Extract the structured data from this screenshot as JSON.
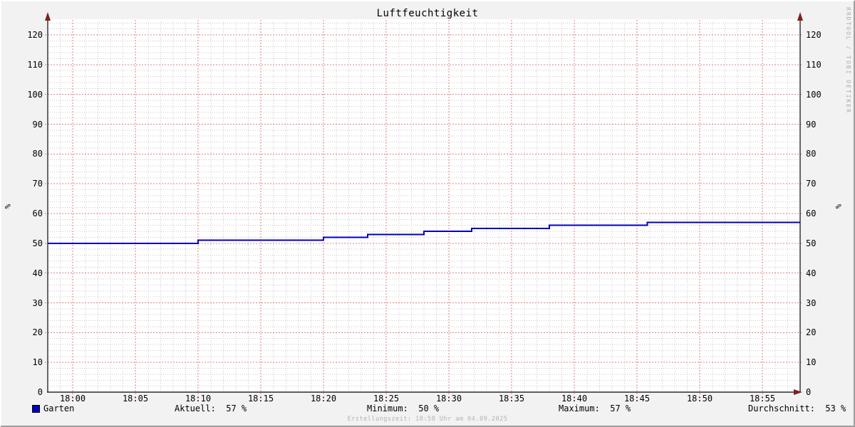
{
  "title": "Luftfeuchtigkeit",
  "watermark": "RRDTOOL / TOBI OETIKER",
  "footer": "Erstellungszeit: 18:58 Uhr am 04.09.2025",
  "y_axis_unit": "%",
  "legend": {
    "series_label": "Garten",
    "stats": {
      "aktuell": "Aktuell:  57 %",
      "minimum": "Minimum:  50 %",
      "maximum": "Maximum:  57 %",
      "durchschnitt": "Durchschnitt:  53 %"
    }
  },
  "colors": {
    "background": "#f2f2f2",
    "canvas": "#ffffff",
    "line": "#0000b8",
    "legend_swatch": "#0000b8",
    "major_grid": "#e08080",
    "minor_grid": "#c9c9c9",
    "axis": "#2a2a2a",
    "arrow": "#7f1f1f",
    "text": "#000000",
    "muted_text": "#b3b3b3",
    "watermark_text": "#adadad"
  },
  "chart_data": {
    "type": "line",
    "title": "Luftfeuchtigkeit",
    "ylabel": "%",
    "x_start": "17:58",
    "x_end": "18:58",
    "x_total_minutes": 60,
    "x_minor_step_minutes": 1,
    "x_ticks": [
      {
        "label": "18:00",
        "t": 2
      },
      {
        "label": "18:05",
        "t": 7
      },
      {
        "label": "18:10",
        "t": 12
      },
      {
        "label": "18:15",
        "t": 17
      },
      {
        "label": "18:20",
        "t": 22
      },
      {
        "label": "18:25",
        "t": 27
      },
      {
        "label": "18:30",
        "t": 32
      },
      {
        "label": "18:35",
        "t": 37
      },
      {
        "label": "18:40",
        "t": 42
      },
      {
        "label": "18:45",
        "t": 47
      },
      {
        "label": "18:50",
        "t": 52
      },
      {
        "label": "18:55",
        "t": 57
      }
    ],
    "y_ticks": [
      0,
      10,
      20,
      30,
      40,
      50,
      60,
      70,
      80,
      90,
      100,
      110,
      120
    ],
    "y_minor_step": 2,
    "ylim": [
      0,
      125
    ],
    "grid": true,
    "legend_position": "bottom",
    "series": [
      {
        "name": "Garten",
        "color": "#0000b8",
        "unit": "%",
        "steps": [
          {
            "t": 0,
            "value": 50
          },
          {
            "t": 12,
            "value": 51
          },
          {
            "t": 22,
            "value": 52
          },
          {
            "t": 25.5,
            "value": 53
          },
          {
            "t": 30,
            "value": 54
          },
          {
            "t": 33.8,
            "value": 55
          },
          {
            "t": 40,
            "value": 56
          },
          {
            "t": 47.8,
            "value": 57
          }
        ],
        "current": 57,
        "min": 50,
        "max": 57,
        "avg": 53
      }
    ]
  }
}
